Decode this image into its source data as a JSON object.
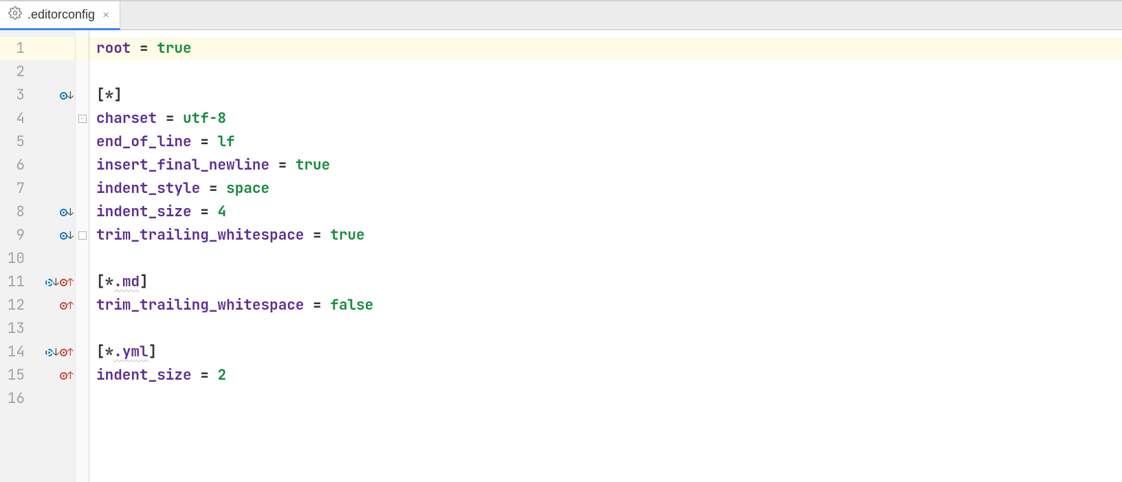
{
  "tab": {
    "filename": ".editorconfig",
    "icon": "gear-icon",
    "close_glyph": "×"
  },
  "editor": {
    "lines": [
      {
        "n": 1,
        "current": true,
        "marks": [],
        "fold": null,
        "tokens": [
          [
            "key",
            "root"
          ],
          [
            "plain",
            " "
          ],
          [
            "op",
            "="
          ],
          [
            "plain",
            " "
          ],
          [
            "val",
            "true"
          ]
        ]
      },
      {
        "n": 2,
        "current": false,
        "marks": [],
        "fold": null,
        "tokens": []
      },
      {
        "n": 3,
        "current": false,
        "marks": [
          "blue-down"
        ],
        "fold": null,
        "tokens": [
          [
            "br",
            "["
          ],
          [
            "op",
            "*"
          ],
          [
            "br",
            "]"
          ]
        ]
      },
      {
        "n": 4,
        "current": false,
        "marks": [],
        "fold": "minus",
        "tokens": [
          [
            "key",
            "charset"
          ],
          [
            "plain",
            " "
          ],
          [
            "op",
            "="
          ],
          [
            "plain",
            " "
          ],
          [
            "val",
            "utf-8"
          ]
        ]
      },
      {
        "n": 5,
        "current": false,
        "marks": [],
        "fold": null,
        "tokens": [
          [
            "key",
            "end_of_line"
          ],
          [
            "plain",
            " "
          ],
          [
            "op",
            "="
          ],
          [
            "plain",
            " "
          ],
          [
            "val",
            "lf"
          ]
        ]
      },
      {
        "n": 6,
        "current": false,
        "marks": [],
        "fold": null,
        "tokens": [
          [
            "key",
            "insert_final_newline"
          ],
          [
            "plain",
            " "
          ],
          [
            "op",
            "="
          ],
          [
            "plain",
            " "
          ],
          [
            "val",
            "true"
          ]
        ]
      },
      {
        "n": 7,
        "current": false,
        "marks": [],
        "fold": null,
        "tokens": [
          [
            "key",
            "indent_style"
          ],
          [
            "plain",
            " "
          ],
          [
            "op",
            "="
          ],
          [
            "plain",
            " "
          ],
          [
            "val",
            "space"
          ]
        ]
      },
      {
        "n": 8,
        "current": false,
        "marks": [
          "blue-down"
        ],
        "fold": null,
        "tokens": [
          [
            "key",
            "indent_size"
          ],
          [
            "plain",
            " "
          ],
          [
            "op",
            "="
          ],
          [
            "plain",
            " "
          ],
          [
            "val",
            "4"
          ]
        ]
      },
      {
        "n": 9,
        "current": false,
        "marks": [
          "blue-down"
        ],
        "fold": "end",
        "tokens": [
          [
            "key",
            "trim_trailing_whitespace"
          ],
          [
            "plain",
            " "
          ],
          [
            "op",
            "="
          ],
          [
            "plain",
            " "
          ],
          [
            "val",
            "true"
          ]
        ]
      },
      {
        "n": 10,
        "current": false,
        "marks": [],
        "fold": null,
        "tokens": []
      },
      {
        "n": 11,
        "current": false,
        "marks": [
          "blue-dashed-down",
          "red-up"
        ],
        "fold": null,
        "tokens": [
          [
            "br",
            "["
          ],
          [
            "op",
            "*"
          ],
          [
            "pat-wavy",
            ".md"
          ],
          [
            "br",
            "]"
          ]
        ]
      },
      {
        "n": 12,
        "current": false,
        "marks": [
          "red-up"
        ],
        "fold": null,
        "tokens": [
          [
            "key",
            "trim_trailing_whitespace"
          ],
          [
            "plain",
            " "
          ],
          [
            "op",
            "="
          ],
          [
            "plain",
            " "
          ],
          [
            "val",
            "false"
          ]
        ]
      },
      {
        "n": 13,
        "current": false,
        "marks": [],
        "fold": null,
        "tokens": []
      },
      {
        "n": 14,
        "current": false,
        "marks": [
          "blue-dashed-down",
          "red-up"
        ],
        "fold": null,
        "tokens": [
          [
            "br",
            "["
          ],
          [
            "op",
            "*"
          ],
          [
            "pat-wavy",
            ".yml"
          ],
          [
            "br",
            "]"
          ]
        ]
      },
      {
        "n": 15,
        "current": false,
        "marks": [
          "red-up"
        ],
        "fold": null,
        "tokens": [
          [
            "key",
            "indent_size"
          ],
          [
            "plain",
            " "
          ],
          [
            "op",
            "="
          ],
          [
            "plain",
            " "
          ],
          [
            "val",
            "2"
          ]
        ]
      },
      {
        "n": 16,
        "current": false,
        "marks": [],
        "fold": null,
        "tokens": []
      }
    ]
  }
}
